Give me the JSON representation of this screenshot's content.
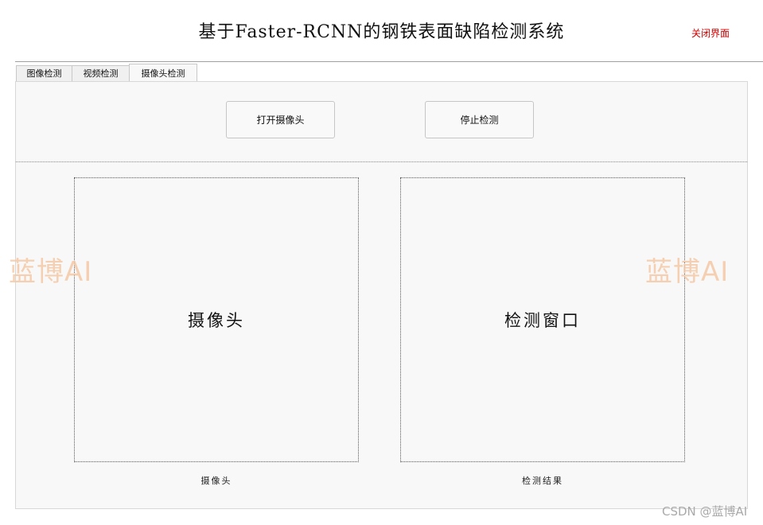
{
  "window": {
    "title": "基于Faster-RCNN的钢铁表面缺陷检测系统",
    "close_label": "关闭界面"
  },
  "tabs": [
    {
      "label": "图像检测",
      "active": false
    },
    {
      "label": "视频检测",
      "active": false
    },
    {
      "label": "摄像头检测",
      "active": true
    }
  ],
  "toolbar": {
    "open_camera_label": "打开摄像头",
    "stop_detection_label": "停止检测"
  },
  "views": {
    "camera_placeholder": "摄像头",
    "detection_placeholder": "检测窗口",
    "camera_caption": "摄像头",
    "result_caption": "检测结果"
  },
  "watermark": {
    "text": "蓝博AI"
  },
  "footer": {
    "credit": "CSDN @蓝博AI"
  },
  "colors": {
    "close_label": "#cc0000",
    "watermark": "#f5c9a6",
    "panel_background": "#f8f8f8"
  }
}
